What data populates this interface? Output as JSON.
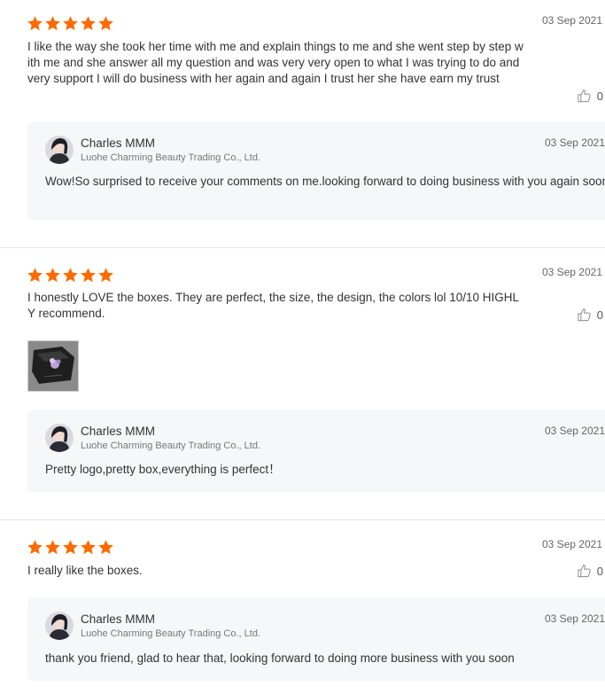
{
  "reviews": [
    {
      "rating": 5,
      "date": "03 Sep 2021",
      "text": "I like the way she took her time with me and explain things to me and she went step by step with me and she answer all my question and was very very open to what I was trying to do and very support I will do business with her again and again I trust her  she have earn my trust",
      "likes": "0",
      "reply": {
        "name": "Charles MMM",
        "company": "Luohe Charming Beauty Trading Co., Ltd.",
        "date": "03 Sep 2021",
        "text": "Wow!So surprised to receive your comments on me.looking forward to doing business with you again soon"
      }
    },
    {
      "rating": 5,
      "date": "03 Sep 2021",
      "text": "I honestly LOVE the boxes. They are perfect, the size, the design, the colors lol 10/10 HIGHLY recommend.",
      "likes": "0",
      "reply": {
        "name": "Charles MMM",
        "company": "Luohe Charming Beauty Trading Co., Ltd.",
        "date": "03 Sep 2021",
        "text": "Pretty logo,pretty box,everything is perfect！"
      }
    },
    {
      "rating": 5,
      "date": "03 Sep 2021",
      "text": "I really like the boxes.",
      "likes": "0",
      "reply": {
        "name": "Charles MMM",
        "company": "Luohe Charming Beauty Trading Co., Ltd.",
        "date": "03 Sep 2021",
        "text": "thank you friend, glad to hear that, looking forward to doing more business with you soon"
      }
    }
  ],
  "colors": {
    "star": "#ff6a00",
    "reply_bg": "#f6f7f8"
  },
  "icons": {
    "like": "thumbs-up-icon",
    "star": "star-icon"
  }
}
